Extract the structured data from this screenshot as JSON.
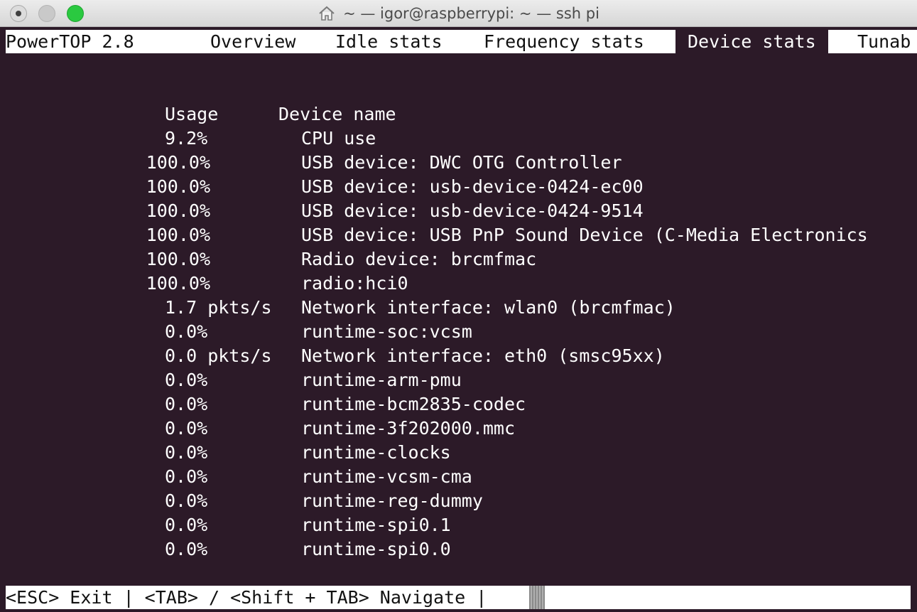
{
  "window": {
    "title": "~ — igor@raspberrypi: ~ — ssh pi"
  },
  "menubar": {
    "app": "PowerTOP 2.8",
    "tabs": [
      "Overview",
      "Idle stats",
      "Frequency stats",
      "Device stats",
      "Tunab"
    ],
    "active_tab": "Device stats"
  },
  "table": {
    "headers": {
      "usage": "Usage",
      "device": "Device name"
    },
    "rows": [
      {
        "usage": "9.2%",
        "device": "CPU use"
      },
      {
        "usage": "100.0%",
        "device": "USB device: DWC OTG Controller"
      },
      {
        "usage": "100.0%",
        "device": "USB device: usb-device-0424-ec00"
      },
      {
        "usage": "100.0%",
        "device": "USB device: usb-device-0424-9514"
      },
      {
        "usage": "100.0%",
        "device": "USB device: USB PnP Sound Device (C-Media Electronics"
      },
      {
        "usage": "100.0%",
        "device": "Radio device: brcmfmac"
      },
      {
        "usage": "100.0%",
        "device": "radio:hci0"
      },
      {
        "usage": "1.7 pkts/s",
        "device": "Network interface: wlan0 (brcmfmac)"
      },
      {
        "usage": "0.0%",
        "device": "runtime-soc:vcsm"
      },
      {
        "usage": "0.0 pkts/s",
        "device": "Network interface: eth0 (smsc95xx)"
      },
      {
        "usage": "0.0%",
        "device": "runtime-arm-pmu"
      },
      {
        "usage": "0.0%",
        "device": "runtime-bcm2835-codec"
      },
      {
        "usage": "0.0%",
        "device": "runtime-3f202000.mmc"
      },
      {
        "usage": "0.0%",
        "device": "runtime-clocks"
      },
      {
        "usage": "0.0%",
        "device": "runtime-vcsm-cma"
      },
      {
        "usage": "0.0%",
        "device": "runtime-reg-dummy"
      },
      {
        "usage": "0.0%",
        "device": "runtime-spi0.1"
      },
      {
        "usage": "0.0%",
        "device": "runtime-spi0.0"
      }
    ]
  },
  "status": {
    "text": "<ESC> Exit | <TAB> / <Shift + TAB> Navigate |"
  },
  "colors": {
    "terminal_bg": "#2c1a28",
    "terminal_fg": "#ffffff",
    "bar_bg": "#ffffff",
    "zoom_button": "#2ac940"
  },
  "icons": {
    "home": "home-icon"
  }
}
